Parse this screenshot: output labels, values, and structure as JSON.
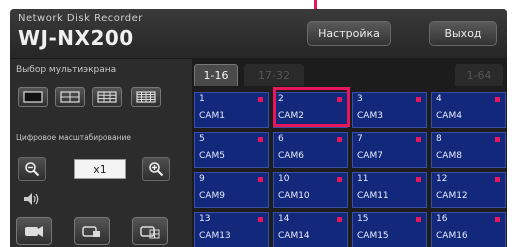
{
  "window": {
    "subtitle": "Network Disk Recorder",
    "title": "WJ-NX200"
  },
  "toolbar": {
    "settings_label": "Настройка",
    "exit_label": "Выход"
  },
  "left_panel": {
    "layout_label": "Выбор мультиэкрана",
    "zoom_label": "Цифровое масштабирование",
    "zoom_value": "x1"
  },
  "tabs": [
    {
      "label": "1-16"
    },
    {
      "label": "17-32"
    },
    {
      "label": "1-64"
    }
  ],
  "cameras": [
    {
      "num": "1",
      "label": "CAM1"
    },
    {
      "num": "2",
      "label": "CAM2"
    },
    {
      "num": "3",
      "label": "CAM3"
    },
    {
      "num": "4",
      "label": "CAM4"
    },
    {
      "num": "5",
      "label": "CAM5"
    },
    {
      "num": "6",
      "label": "CAM6"
    },
    {
      "num": "7",
      "label": "CAM7"
    },
    {
      "num": "8",
      "label": "CAM8"
    },
    {
      "num": "9",
      "label": "CAM9"
    },
    {
      "num": "10",
      "label": "CAM10"
    },
    {
      "num": "11",
      "label": "CAM11"
    },
    {
      "num": "12",
      "label": "CAM12"
    },
    {
      "num": "13",
      "label": "CAM13"
    },
    {
      "num": "14",
      "label": "CAM14"
    },
    {
      "num": "15",
      "label": "CAM15"
    },
    {
      "num": "16",
      "label": "CAM16"
    }
  ],
  "colors": {
    "accent": "#e8175d",
    "cam_tile": "#12287a"
  }
}
